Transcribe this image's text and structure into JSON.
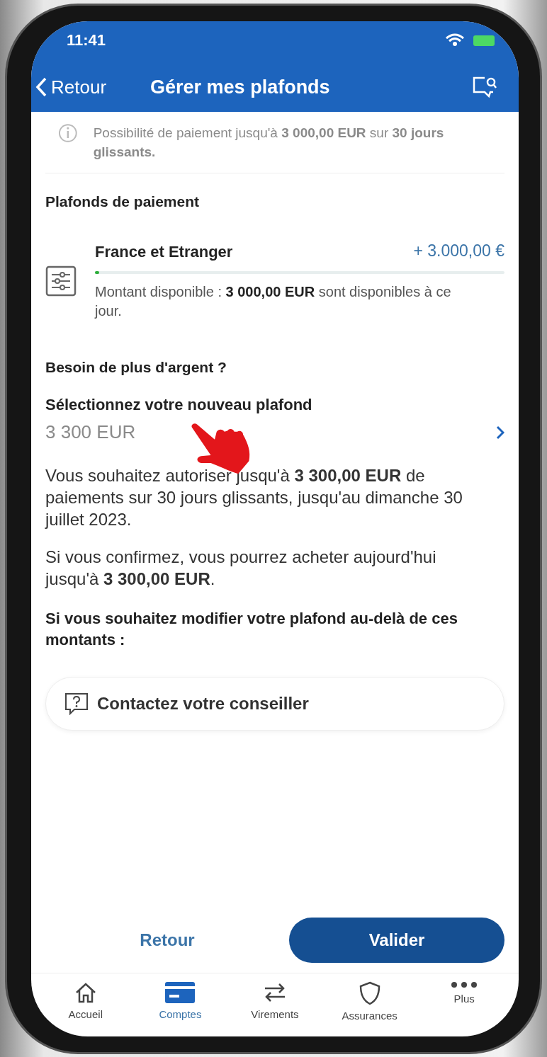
{
  "status_bar": {
    "time": "11:41"
  },
  "header": {
    "back": "Retour",
    "title": "Gérer mes plafonds"
  },
  "info": "Possibilité de paiement jusqu'à **3 000,00 EUR** sur **30 jours glissants.**",
  "section_title": "Plafonds de paiement",
  "limit": {
    "name": "France et Etranger",
    "amount": "+ 3.000,00 €",
    "level": 0.01,
    "detail": "Montant disponible :  **3 000,00 EUR**  sont disponibles à ce jour."
  },
  "need_more": "Besoin de plus d'argent ?",
  "select": {
    "label": "Sélectionnez votre nouveau plafond",
    "value": "3 300 EUR"
  },
  "paragraphs": [
    "Vous souhaitez autoriser jusqu'à **3 300,00 EUR** de paiements sur 30 jours glissants, jusqu'au dimanche 30 juillet 2023.",
    "Si vous confirmez, vous pourrez acheter aujourd'hui jusqu'à **3 300,00 EUR**."
  ],
  "beyond": "Si vous souhaitez modifier votre plafond au-delà de ces montants :",
  "contact_button": "Contactez votre conseiller",
  "actions": {
    "secondary": "Retour",
    "primary": "Valider"
  },
  "tabs": [
    {
      "kind": "home",
      "label": "Accueil",
      "selected": false
    },
    {
      "kind": "card",
      "label": "Comptes",
      "selected": true
    },
    {
      "kind": "transfer",
      "label": "Virements",
      "selected": false
    },
    {
      "kind": "shield",
      "label": "Assurances",
      "selected": false
    },
    {
      "kind": "more",
      "label": "Plus",
      "selected": false
    }
  ]
}
